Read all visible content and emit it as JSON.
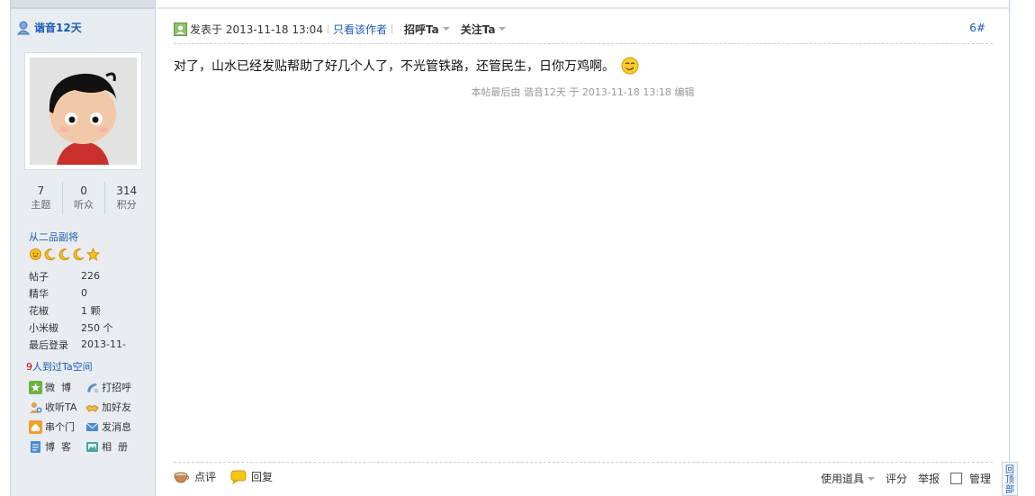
{
  "author": {
    "name": "谐音12天",
    "stats": [
      {
        "value": "7",
        "label": "主题"
      },
      {
        "value": "0",
        "label": "听众"
      },
      {
        "value": "314",
        "label": "积分"
      }
    ],
    "rank": "从二品副将",
    "info": [
      {
        "key": "帖子",
        "value": "226"
      },
      {
        "key": "精华",
        "value": "0"
      },
      {
        "key": "花椒",
        "value": "1 颗"
      },
      {
        "key": "小米椒",
        "value": "250 个"
      },
      {
        "key": "最后登录",
        "value": "2013-11-"
      }
    ],
    "visited_count": "9",
    "visited_text": "人到过Ta空间",
    "actions": [
      {
        "label": "微  博",
        "icon": "weibo-icon"
      },
      {
        "label": "打招呼",
        "icon": "greet-icon"
      },
      {
        "label": "收听TA",
        "icon": "follow-icon"
      },
      {
        "label": "加好友",
        "icon": "add-friend-icon"
      },
      {
        "label": "串个门",
        "icon": "home-icon"
      },
      {
        "label": "发消息",
        "icon": "message-icon"
      },
      {
        "label": "博  客",
        "icon": "blog-icon"
      },
      {
        "label": "相  册",
        "icon": "album-icon"
      }
    ]
  },
  "post": {
    "posted_label": "发表于 2013-11-18 13:04",
    "only_author": "只看该作者",
    "greet": "招呼Ta",
    "follow": "关注Ta",
    "floor": "6#",
    "content": "对了，山水已经发贴帮助了好几个人了，不光管铁路，还管民生，日你万鸡啊。",
    "edited_note": "本帖最后由 谐音12天 于 2013-11-18 13:18 编辑"
  },
  "footer": {
    "comment": "点评",
    "reply": "回复",
    "use_tool": "使用道具",
    "rate": "评分",
    "report": "举报",
    "manage": "管理"
  },
  "back_to_top": "回顶部",
  "colors": {
    "link": "#1a5bb8",
    "sidebar_bg": "#e9edf1",
    "border": "#c2d5e3"
  }
}
